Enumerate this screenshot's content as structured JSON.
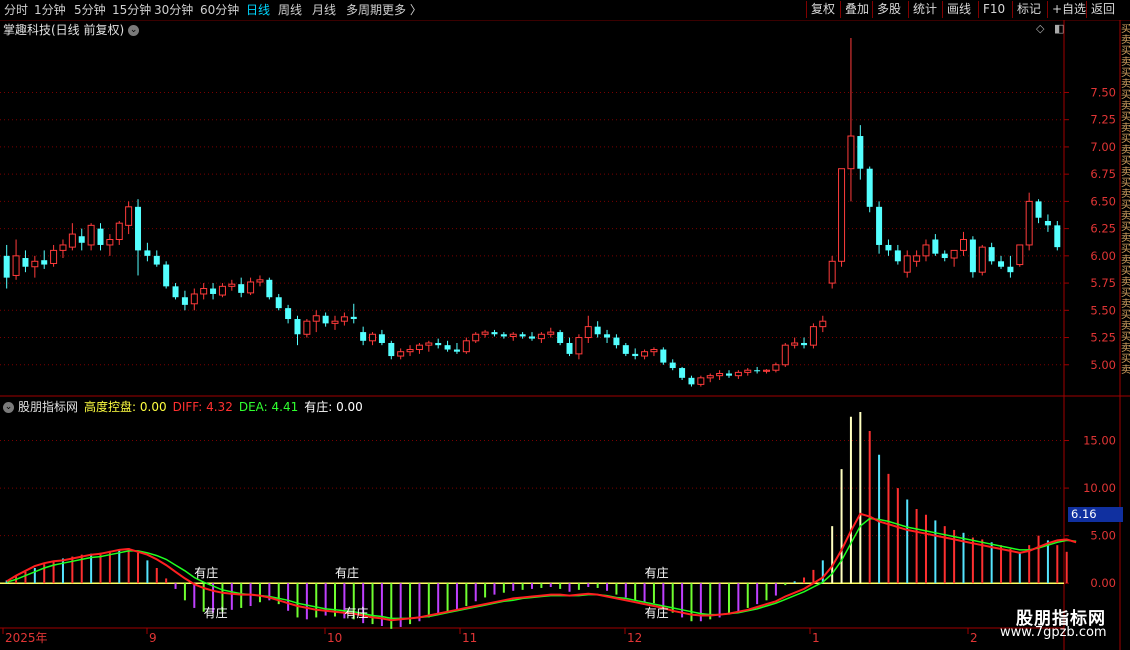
{
  "toolbar": {
    "periods": [
      {
        "label": "分时",
        "active": false
      },
      {
        "label": "1分钟",
        "active": false
      },
      {
        "label": "5分钟",
        "active": false
      },
      {
        "label": "15分钟",
        "active": false
      },
      {
        "label": "30分钟",
        "active": false
      },
      {
        "label": "60分钟",
        "active": false
      },
      {
        "label": "日线",
        "active": true
      },
      {
        "label": "周线",
        "active": false
      },
      {
        "label": "月线",
        "active": false
      },
      {
        "label": "多周期",
        "active": false
      },
      {
        "label": "更多 〉",
        "active": false
      }
    ],
    "right_buttons": [
      "复权",
      "叠加",
      "多股",
      "统计",
      "画线",
      "F10",
      "标记",
      "+自选",
      "返回"
    ]
  },
  "main_chart": {
    "title": "掌趣科技(日线 前复权)",
    "y_ticks": [
      "7.50",
      "7.25",
      "7.00",
      "6.75",
      "6.50",
      "6.25",
      "6.00",
      "5.75",
      "5.50",
      "5.25",
      "5.00"
    ]
  },
  "indicator": {
    "name": "股朋指标网",
    "items": [
      {
        "label": "高度控盘: 0.00",
        "color": "#ffff40"
      },
      {
        "label": "DIFF: 4.32",
        "color": "#ff3030"
      },
      {
        "label": "DEA: 4.41",
        "color": "#30ff30"
      },
      {
        "label": "有庄: 0.00",
        "color": "#ffffff"
      }
    ],
    "y_ticks": [
      "15.00",
      "10.00",
      "5.00",
      "0.00"
    ],
    "current_value": "6.16",
    "markers": [
      "有庄",
      "有庄",
      "有庄",
      "有庄",
      "有庄",
      "有庄"
    ]
  },
  "x_axis": {
    "labels": [
      "2025年",
      "9",
      "10",
      "11",
      "12",
      "1",
      "2"
    ]
  },
  "watermark": {
    "title": "股朋指标网",
    "url": "www.7gpzb.com"
  },
  "colors": {
    "up": "#ff3b3b",
    "down": "#54ffff",
    "grid": "#7a0000",
    "axis": "#a00000",
    "diff": "#ff2020",
    "dea": "#20ff20"
  },
  "chart_data": {
    "type": "candlestick",
    "ohlc": [
      [
        6.0,
        6.1,
        5.7,
        5.8
      ],
      [
        5.82,
        6.15,
        5.78,
        6.0
      ],
      [
        5.98,
        6.05,
        5.85,
        5.9
      ],
      [
        5.9,
        6.0,
        5.8,
        5.95
      ],
      [
        5.96,
        6.05,
        5.88,
        5.92
      ],
      [
        5.93,
        6.1,
        5.9,
        6.05
      ],
      [
        6.05,
        6.15,
        5.98,
        6.1
      ],
      [
        6.08,
        6.3,
        6.05,
        6.2
      ],
      [
        6.18,
        6.25,
        6.05,
        6.12
      ],
      [
        6.1,
        6.3,
        6.05,
        6.28
      ],
      [
        6.25,
        6.3,
        6.05,
        6.1
      ],
      [
        6.1,
        6.2,
        6.0,
        6.15
      ],
      [
        6.15,
        6.32,
        6.1,
        6.3
      ],
      [
        6.28,
        6.5,
        6.2,
        6.45
      ],
      [
        6.45,
        6.52,
        5.82,
        6.05
      ],
      [
        6.05,
        6.12,
        5.95,
        6.0
      ],
      [
        6.0,
        6.05,
        5.9,
        5.92
      ],
      [
        5.92,
        5.95,
        5.7,
        5.72
      ],
      [
        5.72,
        5.75,
        5.6,
        5.62
      ],
      [
        5.62,
        5.68,
        5.5,
        5.55
      ],
      [
        5.56,
        5.7,
        5.5,
        5.65
      ],
      [
        5.65,
        5.75,
        5.6,
        5.7
      ],
      [
        5.7,
        5.75,
        5.6,
        5.65
      ],
      [
        5.64,
        5.75,
        5.62,
        5.72
      ],
      [
        5.72,
        5.78,
        5.68,
        5.74
      ],
      [
        5.74,
        5.8,
        5.62,
        5.66
      ],
      [
        5.66,
        5.8,
        5.64,
        5.76
      ],
      [
        5.76,
        5.82,
        5.72,
        5.78
      ],
      [
        5.78,
        5.8,
        5.6,
        5.62
      ],
      [
        5.62,
        5.65,
        5.5,
        5.52
      ],
      [
        5.52,
        5.55,
        5.38,
        5.42
      ],
      [
        5.42,
        5.45,
        5.18,
        5.28
      ],
      [
        5.28,
        5.42,
        5.25,
        5.4
      ],
      [
        5.4,
        5.5,
        5.3,
        5.45
      ],
      [
        5.45,
        5.48,
        5.35,
        5.38
      ],
      [
        5.38,
        5.45,
        5.32,
        5.4
      ],
      [
        5.4,
        5.48,
        5.36,
        5.44
      ],
      [
        5.44,
        5.56,
        5.38,
        5.42
      ],
      [
        5.3,
        5.35,
        5.18,
        5.22
      ],
      [
        5.22,
        5.3,
        5.18,
        5.28
      ],
      [
        5.28,
        5.32,
        5.18,
        5.2
      ],
      [
        5.2,
        5.22,
        5.05,
        5.08
      ],
      [
        5.08,
        5.15,
        5.05,
        5.12
      ],
      [
        5.12,
        5.18,
        5.08,
        5.14
      ],
      [
        5.14,
        5.2,
        5.1,
        5.18
      ],
      [
        5.18,
        5.22,
        5.12,
        5.2
      ],
      [
        5.2,
        5.24,
        5.15,
        5.18
      ],
      [
        5.18,
        5.22,
        5.12,
        5.14
      ],
      [
        5.14,
        5.2,
        5.1,
        5.12
      ],
      [
        5.12,
        5.25,
        5.1,
        5.22
      ],
      [
        5.22,
        5.3,
        5.2,
        5.28
      ],
      [
        5.28,
        5.32,
        5.25,
        5.3
      ],
      [
        5.3,
        5.32,
        5.26,
        5.28
      ],
      [
        5.28,
        5.3,
        5.24,
        5.26
      ],
      [
        5.26,
        5.3,
        5.22,
        5.28
      ],
      [
        5.28,
        5.3,
        5.24,
        5.26
      ],
      [
        5.26,
        5.3,
        5.22,
        5.24
      ],
      [
        5.24,
        5.3,
        5.2,
        5.28
      ],
      [
        5.28,
        5.34,
        5.25,
        5.3
      ],
      [
        5.3,
        5.32,
        5.18,
        5.2
      ],
      [
        5.2,
        5.25,
        5.08,
        5.1
      ],
      [
        5.1,
        5.28,
        5.05,
        5.25
      ],
      [
        5.25,
        5.45,
        5.2,
        5.35
      ],
      [
        5.35,
        5.4,
        5.25,
        5.28
      ],
      [
        5.28,
        5.32,
        5.2,
        5.25
      ],
      [
        5.25,
        5.28,
        5.15,
        5.18
      ],
      [
        5.18,
        5.2,
        5.08,
        5.1
      ],
      [
        5.1,
        5.15,
        5.05,
        5.08
      ],
      [
        5.08,
        5.14,
        5.05,
        5.12
      ],
      [
        5.12,
        5.16,
        5.08,
        5.14
      ],
      [
        5.14,
        5.16,
        5.0,
        5.02
      ],
      [
        5.02,
        5.05,
        4.95,
        4.97
      ],
      [
        4.97,
        4.98,
        4.86,
        4.88
      ],
      [
        4.88,
        4.9,
        4.8,
        4.82
      ],
      [
        4.82,
        4.9,
        4.8,
        4.88
      ],
      [
        4.88,
        4.92,
        4.84,
        4.9
      ],
      [
        4.9,
        4.95,
        4.86,
        4.92
      ],
      [
        4.92,
        4.95,
        4.88,
        4.9
      ],
      [
        4.9,
        4.95,
        4.87,
        4.93
      ],
      [
        4.93,
        4.97,
        4.9,
        4.95
      ],
      [
        4.95,
        4.98,
        4.92,
        4.94
      ],
      [
        4.94,
        4.96,
        4.92,
        4.95
      ],
      [
        4.95,
        5.02,
        4.93,
        5.0
      ],
      [
        5.0,
        5.2,
        4.98,
        5.18
      ],
      [
        5.18,
        5.25,
        5.15,
        5.2
      ],
      [
        5.2,
        5.25,
        5.15,
        5.18
      ],
      [
        5.18,
        5.38,
        5.15,
        5.35
      ],
      [
        5.35,
        5.45,
        5.3,
        5.4
      ],
      [
        5.75,
        6.0,
        5.7,
        5.95
      ],
      [
        5.95,
        6.25,
        5.9,
        6.8
      ],
      [
        6.8,
        8.0,
        6.5,
        7.1
      ],
      [
        7.1,
        7.2,
        6.7,
        6.8
      ],
      [
        6.8,
        6.82,
        6.4,
        6.45
      ],
      [
        6.45,
        6.5,
        6.02,
        6.1
      ],
      [
        6.1,
        6.15,
        6.0,
        6.05
      ],
      [
        6.05,
        6.1,
        5.92,
        5.95
      ],
      [
        5.85,
        6.05,
        5.8,
        6.0
      ],
      [
        5.95,
        6.05,
        5.9,
        6.0
      ],
      [
        6.0,
        6.15,
        5.95,
        6.1
      ],
      [
        6.15,
        6.2,
        6.0,
        6.02
      ],
      [
        6.02,
        6.05,
        5.95,
        5.98
      ],
      [
        5.98,
        6.05,
        5.9,
        6.05
      ],
      [
        6.05,
        6.22,
        6.0,
        6.15
      ],
      [
        6.15,
        6.18,
        5.8,
        5.85
      ],
      [
        5.85,
        6.1,
        5.82,
        6.08
      ],
      [
        6.08,
        6.12,
        5.92,
        5.95
      ],
      [
        5.95,
        6.0,
        5.88,
        5.9
      ],
      [
        5.9,
        6.0,
        5.8,
        5.85
      ],
      [
        5.92,
        6.1,
        5.9,
        6.1
      ],
      [
        6.1,
        6.58,
        6.05,
        6.5
      ],
      [
        6.5,
        6.52,
        6.3,
        6.35
      ],
      [
        6.32,
        6.38,
        6.22,
        6.28
      ],
      [
        6.28,
        6.32,
        6.05,
        6.08
      ]
    ],
    "macd": [
      0.3,
      0.8,
      1.2,
      1.6,
      2.0,
      2.3,
      2.6,
      2.8,
      3.0,
      3.1,
      3.2,
      3.4,
      3.5,
      3.7,
      3.2,
      2.4,
      1.6,
      0.5,
      -0.6,
      -1.8,
      -2.6,
      -3.0,
      -3.1,
      -3.0,
      -2.8,
      -2.6,
      -2.4,
      -2.0,
      -1.8,
      -2.2,
      -2.9,
      -3.6,
      -3.8,
      -3.6,
      -3.4,
      -3.5,
      -3.7,
      -3.8,
      -4.2,
      -4.3,
      -4.5,
      -4.8,
      -4.6,
      -4.3,
      -4.0,
      -3.6,
      -3.2,
      -3.0,
      -2.8,
      -2.4,
      -1.9,
      -1.5,
      -1.2,
      -1.0,
      -0.8,
      -0.7,
      -0.6,
      -0.5,
      -0.4,
      -0.6,
      -0.9,
      -0.7,
      -0.4,
      -0.5,
      -0.8,
      -1.2,
      -1.5,
      -1.8,
      -2.0,
      -2.1,
      -2.6,
      -3.1,
      -3.6,
      -4.0,
      -4.0,
      -3.8,
      -3.6,
      -3.3,
      -3.0,
      -2.6,
      -2.2,
      -1.8,
      -1.3,
      -0.2,
      0.2,
      0.6,
      1.4,
      2.4,
      6.0,
      12.0,
      17.5,
      18.0,
      16.0,
      13.5,
      11.5,
      10.0,
      8.8,
      7.8,
      7.2,
      6.6,
      6.0,
      5.6,
      5.3,
      4.8,
      4.6,
      4.3,
      4.0,
      3.6,
      3.2,
      4.0,
      5.0,
      4.5,
      4.0,
      3.3
    ],
    "diff": [
      0.2,
      0.8,
      1.3,
      1.8,
      2.1,
      2.3,
      2.4,
      2.6,
      2.8,
      3.0,
      3.1,
      3.3,
      3.5,
      3.6,
      3.3,
      3.0,
      2.5,
      1.9,
      1.2,
      0.5,
      -0.1,
      -0.5,
      -0.8,
      -1.0,
      -1.1,
      -1.2,
      -1.2,
      -1.3,
      -1.5,
      -1.8,
      -2.1,
      -2.4,
      -2.6,
      -2.8,
      -2.9,
      -3.0,
      -3.1,
      -3.2,
      -3.4,
      -3.6,
      -3.7,
      -3.9,
      -3.8,
      -3.7,
      -3.6,
      -3.4,
      -3.2,
      -3.0,
      -2.8,
      -2.6,
      -2.4,
      -2.2,
      -2.0,
      -1.8,
      -1.6,
      -1.5,
      -1.4,
      -1.3,
      -1.2,
      -1.2,
      -1.3,
      -1.2,
      -1.1,
      -1.2,
      -1.4,
      -1.6,
      -1.8,
      -2.0,
      -2.2,
      -2.4,
      -2.6,
      -2.9,
      -3.1,
      -3.3,
      -3.4,
      -3.4,
      -3.3,
      -3.2,
      -3.0,
      -2.8,
      -2.5,
      -2.2,
      -1.9,
      -1.4,
      -1.0,
      -0.6,
      0.0,
      0.6,
      1.8,
      3.5,
      5.5,
      7.3,
      7.0,
      6.5,
      6.2,
      5.9,
      5.6,
      5.4,
      5.2,
      5.0,
      4.8,
      4.6,
      4.4,
      4.2,
      4.0,
      3.8,
      3.6,
      3.4,
      3.2,
      3.4,
      3.8,
      4.2,
      4.5,
      4.6,
      4.3
    ],
    "dea": [
      0.1,
      0.4,
      0.8,
      1.2,
      1.6,
      1.9,
      2.1,
      2.3,
      2.5,
      2.7,
      2.8,
      3.0,
      3.2,
      3.4,
      3.4,
      3.2,
      2.9,
      2.5,
      1.9,
      1.3,
      0.6,
      0.1,
      -0.3,
      -0.7,
      -0.9,
      -1.1,
      -1.2,
      -1.3,
      -1.4,
      -1.6,
      -1.8,
      -2.1,
      -2.3,
      -2.5,
      -2.7,
      -2.8,
      -2.9,
      -3.0,
      -3.2,
      -3.4,
      -3.5,
      -3.7,
      -3.7,
      -3.7,
      -3.6,
      -3.5,
      -3.3,
      -3.1,
      -2.9,
      -2.7,
      -2.5,
      -2.3,
      -2.1,
      -1.9,
      -1.8,
      -1.6,
      -1.5,
      -1.4,
      -1.3,
      -1.3,
      -1.3,
      -1.3,
      -1.2,
      -1.2,
      -1.3,
      -1.5,
      -1.6,
      -1.8,
      -2.0,
      -2.2,
      -2.4,
      -2.6,
      -2.8,
      -3.0,
      -3.2,
      -3.3,
      -3.3,
      -3.2,
      -3.1,
      -2.9,
      -2.7,
      -2.4,
      -2.1,
      -1.7,
      -1.3,
      -0.9,
      -0.4,
      0.1,
      1.0,
      2.4,
      4.2,
      6.0,
      6.8,
      6.7,
      6.5,
      6.2,
      5.9,
      5.7,
      5.5,
      5.3,
      5.1,
      4.9,
      4.7,
      4.5,
      4.3,
      4.1,
      3.9,
      3.7,
      3.5,
      3.5,
      3.7,
      4.0,
      4.3,
      4.5,
      4.41
    ],
    "ylim_price": [
      4.75,
      8.0
    ],
    "ylim_indicator": [
      -4.5,
      18.0
    ]
  }
}
